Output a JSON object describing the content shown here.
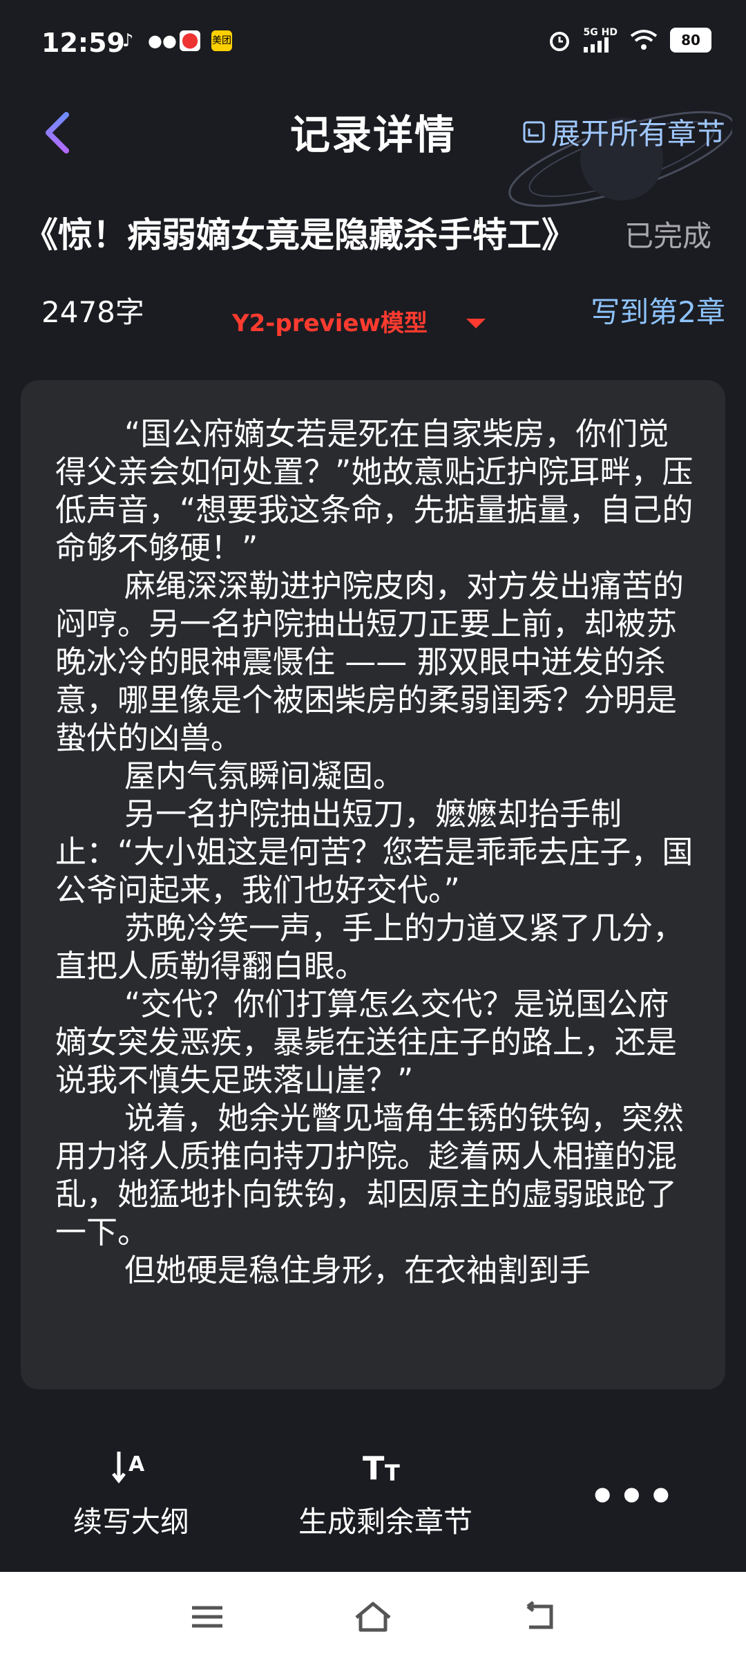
{
  "status_bar": {
    "time": "12:59",
    "apps": [
      "tiktok-icon",
      "wechat-icon",
      "maps-icon",
      "meituan-icon"
    ],
    "meituan_label": "美团",
    "network": "5G HD",
    "battery": "80"
  },
  "header": {
    "title": "记录详情",
    "expand_all": "展开所有章节"
  },
  "novel": {
    "title": "《惊！病弱嫡女竟是隐藏杀手特工》",
    "status": "已完成",
    "word_count": "2478字",
    "model": "Y2-preview模型",
    "progress": "写到第2章"
  },
  "content": {
    "paragraphs": [
      "“国公府嫡女若是死在自家柴房，你们觉得父亲会如何处置？”她故意贴近护院耳畔，压低声音，“想要我这条命，先掂量掂量，自己的命够不够硬！”",
      "麻绳深深勒进护院皮肉，对方发出痛苦的闷哼。另一名护院抽出短刀正要上前，却被苏晚冰冷的眼神震慑住 —— 那双眼中迸发的杀意，哪里像是个被困柴房的柔弱闺秀？分明是蛰伏的凶兽。",
      "屋内气氛瞬间凝固。",
      "另一名护院抽出短刀，嬷嬷却抬手制止：“大小姐这是何苦？您若是乖乖去庄子，国公爷问起来，我们也好交代。”",
      "苏晚冷笑一声，手上的力道又紧了几分，直把人质勒得翻白眼。",
      "“交代？你们打算怎么交代？是说国公府嫡女突发恶疾，暴毙在送往庄子的路上，还是说我不慎失足跌落山崖？”",
      "说着，她余光瞥见墙角生锈的铁钩，突然用力将人质推向持刀护院。趁着两人相撞的混乱，她猛地扑向铁钩，却因原主的虚弱踉跄了一下。",
      "但她硬是稳住身形，在衣袖割到手"
    ]
  },
  "actions": {
    "continue_outline": "续写大纲",
    "generate_remaining": "生成剩余章节",
    "more": "•••"
  },
  "colors": {
    "background": "#1b1c21",
    "card": "#2a2b2f",
    "accent_blue": "#8ec4ff",
    "model_red": "#ff3b30"
  }
}
